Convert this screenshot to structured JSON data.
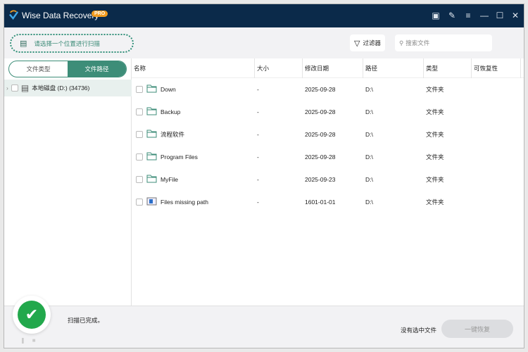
{
  "app": {
    "title": "Wise Data Recovery",
    "badge": "PRO"
  },
  "toolbar": {
    "scan_location": "请选择一个位置进行扫描",
    "filter": "过滤器",
    "search_placeholder": "搜索文件"
  },
  "left": {
    "tabs": [
      "文件类型",
      "文件路径"
    ],
    "active_tab": 1,
    "drive": "本地磁盘 (D:) (34736)"
  },
  "table": {
    "headers": [
      "名称",
      "大小",
      "修改日期",
      "路径",
      "类型",
      "可恢复性"
    ],
    "rows": [
      {
        "name": "Down",
        "size": "-",
        "date": "2025-09-28",
        "path": "D:\\",
        "type": "文件夹",
        "icon": "folder-icon"
      },
      {
        "name": "Backup",
        "size": "-",
        "date": "2025-09-28",
        "path": "D:\\",
        "type": "文件夹",
        "icon": "folder-icon"
      },
      {
        "name": "流程软件",
        "size": "-",
        "date": "2025-09-28",
        "path": "D:\\",
        "type": "文件夹",
        "icon": "folder-icon"
      },
      {
        "name": "Program Files",
        "size": "-",
        "date": "2025-09-28",
        "path": "D:\\",
        "type": "文件夹",
        "icon": "folder-icon"
      },
      {
        "name": "MyFile",
        "size": "-",
        "date": "2025-09-23",
        "path": "D:\\",
        "type": "文件夹",
        "icon": "folder-icon"
      },
      {
        "name": "Files missing path",
        "size": "-",
        "date": "1601-01-01",
        "path": "D:\\",
        "type": "文件夹",
        "icon": "missing-path-icon"
      }
    ]
  },
  "footer": {
    "status": "扫描已完成。",
    "no_selection": "没有选中文件",
    "recover": "一键恢复"
  },
  "colors": {
    "titlebar": "#0b2a4a",
    "accent": "#3d8d78",
    "success": "#22a84c",
    "pro": "#f39c1f"
  }
}
